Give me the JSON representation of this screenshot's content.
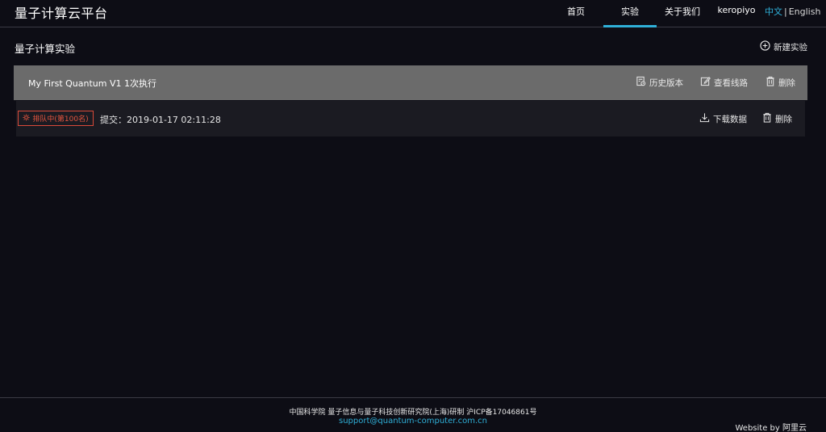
{
  "header": {
    "brand": "量子计算云平台",
    "nav": {
      "home": "首页",
      "experiment": "实验",
      "about": "关于我们",
      "user": "keropiyo"
    },
    "lang": {
      "zh": "中文",
      "separator": "|",
      "en": "English"
    }
  },
  "page": {
    "title": "量子计算实验",
    "new_experiment": "新建实验"
  },
  "experiment": {
    "name": "My First Quantum V1 1次执行",
    "actions": {
      "history": "历史版本",
      "view_circuit": "查看线路",
      "delete": "删除"
    },
    "run": {
      "status": "排队中(第100名)",
      "submitted": "提交：2019-01-17 02:11:28",
      "actions": {
        "download": "下载数据",
        "delete": "删除"
      }
    }
  },
  "footer": {
    "line1": "中国科学院 量子信息与量子科技创新研究院(上海)研制 沪ICP备17046861号",
    "email": "support@quantum-computer.com.cn",
    "credit": "Website by 阿里云"
  },
  "colors": {
    "accent": "#2fb0d8",
    "status_red": "#e3553f",
    "background": "#0d0d15",
    "bar_gray": "#6b6b6b"
  },
  "icons": [
    "plus-circle-icon",
    "history-icon",
    "edit-icon",
    "trash-icon",
    "gear-icon",
    "download-icon"
  ]
}
